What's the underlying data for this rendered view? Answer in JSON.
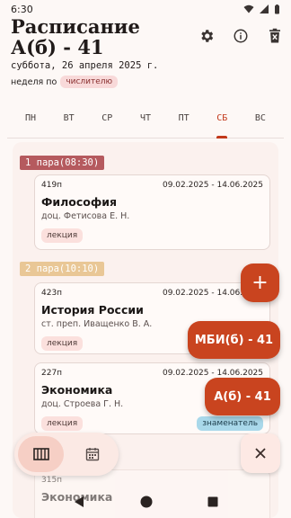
{
  "status": {
    "time": "6:30"
  },
  "header": {
    "title_line1": "Расписание",
    "title_line2": "А(б) - 41",
    "date": "суббота, 26 апреля 2025 г.",
    "week_label": "неделя по",
    "week_value": "числителю"
  },
  "days": [
    "ПН",
    "ВТ",
    "СР",
    "ЧТ",
    "ПТ",
    "СБ",
    "ВС"
  ],
  "active_day": "СБ",
  "slots": [
    {
      "label": "1 пара(08:30)",
      "color": "#b55a5e"
    },
    {
      "label": "2 пара(10:10)",
      "color": "#e9c796"
    }
  ],
  "classes": [
    {
      "room": "419п",
      "dates": "09.02.2025 - 14.06.2025",
      "subject": "Философия",
      "teacher": "доц. Фетисова Е. Н.",
      "type": "лекция",
      "week": ""
    },
    {
      "room": "423п",
      "dates": "09.02.2025 - 14.06.2025",
      "subject": "История России",
      "teacher": "ст. преп. Иващенко В. А.",
      "type": "лекция",
      "week": ""
    },
    {
      "room": "227п",
      "dates": "09.02.2025 - 14.06.2025",
      "subject": "Экономика",
      "teacher": "доц. Строева Г. Н.",
      "type": "лекция",
      "week": "знаменатель"
    },
    {
      "room": "315п",
      "dates": "",
      "subject": "Экономика",
      "teacher": "",
      "type": "",
      "week": ""
    }
  ],
  "fabs": {
    "add": "+",
    "group1": "МБИ(б) - 41",
    "group2": "А(б) - 41",
    "close": "✕"
  },
  "colors": {
    "accent": "#c2391b",
    "fab": "#c9441f"
  },
  "icons": {
    "settings": "gear-icon",
    "info": "info-icon",
    "delete": "delete-icon",
    "week_view": "columns-icon",
    "calendar": "calendar-icon"
  }
}
